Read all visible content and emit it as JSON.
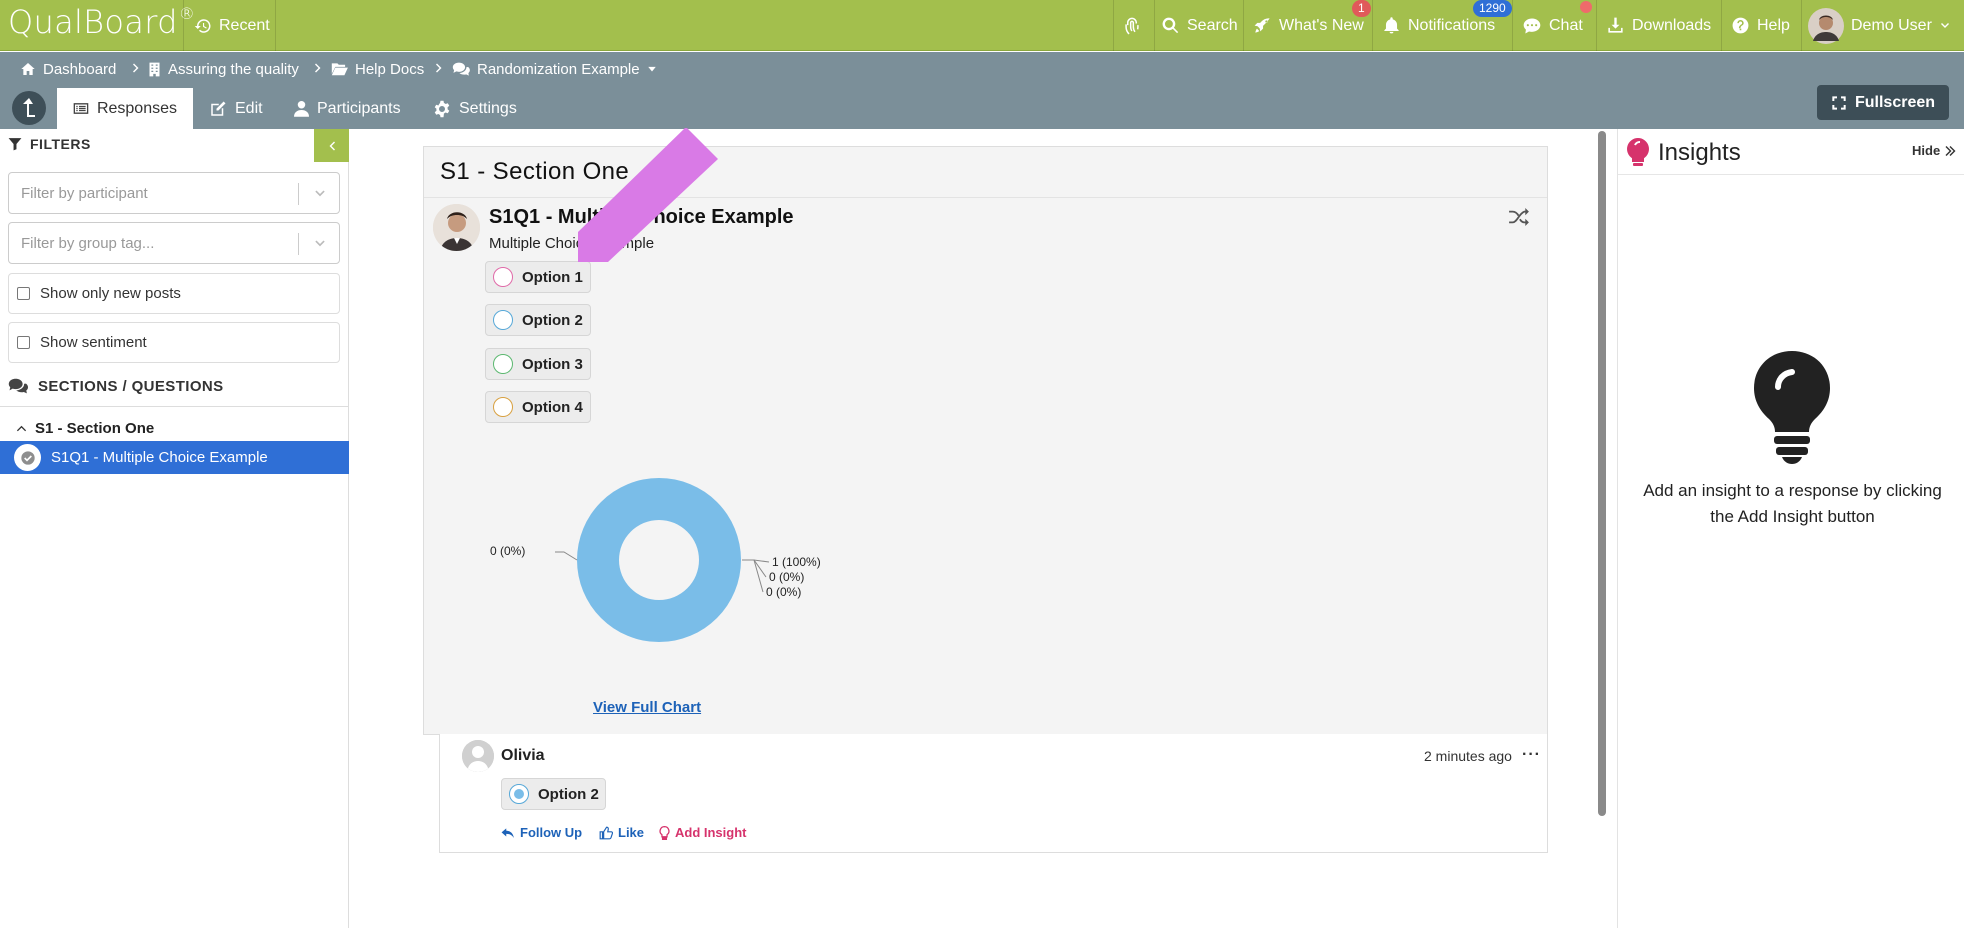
{
  "app": {
    "logo": "QualBoard",
    "logo_mark": "®",
    "recent": "Recent"
  },
  "topnav": {
    "search": "Search",
    "whats_new": "What's New",
    "whats_new_badge": "1",
    "notifications": "Notifications",
    "notifications_badge": "1290",
    "chat": "Chat",
    "downloads": "Downloads",
    "help": "Help",
    "user": "Demo User"
  },
  "breadcrumb": {
    "dashboard": "Dashboard",
    "project": "Assuring the quality",
    "folder": "Help Docs",
    "current": "Randomization Example"
  },
  "tabs": {
    "responses": "Responses",
    "edit": "Edit",
    "participants": "Participants",
    "settings": "Settings",
    "fullscreen": "Fullscreen"
  },
  "sidebar": {
    "filters_title": "FILTERS",
    "participant_placeholder": "Filter by participant",
    "group_placeholder": "Filter by group tag...",
    "show_new": "Show only new posts",
    "show_sentiment": "Show sentiment",
    "sections_title": "SECTIONS / QUESTIONS",
    "section_label": "S1 - Section One",
    "active_question": "S1Q1 - Multiple Choice Example"
  },
  "main": {
    "section_title": "S1 - Section One",
    "question_title": "S1Q1 - Multiple Choice Example",
    "question_subtitle": "Multiple Choice Example",
    "options": [
      {
        "label": "Option 1",
        "color": "#e06aa8"
      },
      {
        "label": "Option 2",
        "color": "#56a8d8"
      },
      {
        "label": "Option 3",
        "color": "#5cb870"
      },
      {
        "label": "Option 4",
        "color": "#d8a040"
      }
    ],
    "view_full_chart": "View Full Chart"
  },
  "chart_data": {
    "type": "pie",
    "categories": [
      "Option 1",
      "Option 2",
      "Option 3",
      "Option 4"
    ],
    "values": [
      0,
      1,
      0,
      0
    ],
    "labels": [
      "1 (100%)",
      "0 (0%)",
      "0 (0%)",
      "0 (0%)"
    ],
    "colors": [
      "#e06aa8",
      "#7abde8",
      "#5cb870",
      "#d8a040"
    ]
  },
  "response": {
    "name": "Olivia",
    "time": "2 minutes ago",
    "more": "···",
    "answer": "Option 2",
    "answer_color": "#56a8d8",
    "follow_up": "Follow Up",
    "like": "Like",
    "add_insight": "Add Insight"
  },
  "insights": {
    "title": "Insights",
    "hide": "Hide",
    "empty_text": "Add an insight to a response by clicking the Add Insight button"
  },
  "colors": {
    "topbar": "#a3bf4d",
    "subhead": "#7b8f99",
    "active_item": "#2f6fd6",
    "link": "#1d62b8",
    "insight_accent": "#d6336c",
    "annotation_arrow": "#d97ae6"
  }
}
